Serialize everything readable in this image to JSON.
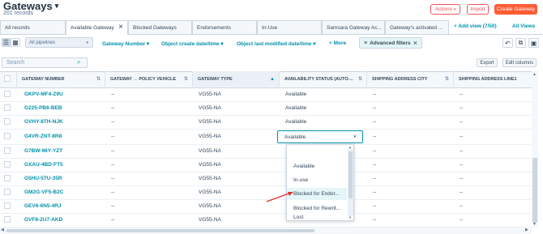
{
  "header": {
    "title": "Gateways",
    "subtitle": "201 records",
    "actions_label": "Actions",
    "import_label": "Import",
    "create_label": "Create Gateway"
  },
  "tabs": [
    {
      "label": "All records"
    },
    {
      "label": "Available Gateway",
      "active": true
    },
    {
      "label": "Blocked Gateways"
    },
    {
      "label": "Endorsements"
    },
    {
      "label": "In-Use"
    },
    {
      "label": "Samsara Gateway Ac..."
    },
    {
      "label": "Gateway's activated ..."
    }
  ],
  "tab_actions": {
    "add_view": "+ Add view (7/50)",
    "all_views": "All Views"
  },
  "filters": {
    "pipeline": "All pipelines",
    "gateway_number": "Gateway Number",
    "create_date": "Object create date/time",
    "modified_date": "Object last modified date/time",
    "more": "+ More",
    "advanced": "Advanced filters"
  },
  "search": {
    "placeholder": "Search",
    "export_label": "Export",
    "edit_columns_label": "Edit columns"
  },
  "table": {
    "columns": [
      "GATEWAY NUMBER",
      "GATEWAY → POLICY VEHICLE",
      "GATEWAY TYPE",
      "AVAILABILITY STATUS (AUTO-...",
      "SHIPPING ADDRESS CITY",
      "SHIPPING ADDRESS LINE1"
    ],
    "rows": [
      {
        "gateway": "GKPV-MF4-Z9U",
        "vehicle": "--",
        "type": "VG55-NA",
        "status": "Available",
        "city": "--",
        "line1": "--"
      },
      {
        "gateway": "G225-PB6-BEB",
        "vehicle": "--",
        "type": "VG55-NA",
        "status": "Available",
        "city": "--",
        "line1": "--"
      },
      {
        "gateway": "GVHY-8TH-NJK",
        "vehicle": "--",
        "type": "VG55-NA",
        "status": "Available",
        "city": "--",
        "line1": "--"
      },
      {
        "gateway": "G4VR-ZNT-8R8",
        "vehicle": "--",
        "type": "VG55-NA",
        "status": "Available",
        "city": "--",
        "line1": "--"
      },
      {
        "gateway": "G7BW-96Y-YZT",
        "vehicle": "--",
        "type": "VG55-NA",
        "status": "",
        "city": "--",
        "line1": "--"
      },
      {
        "gateway": "GXAU-4BD-FT5",
        "vehicle": "--",
        "type": "VG55-NA",
        "status": "",
        "city": "--",
        "line1": "--"
      },
      {
        "gateway": "G5HU-5TU-35R",
        "vehicle": "--",
        "type": "VG55-NA",
        "status": "",
        "city": "--",
        "line1": "--"
      },
      {
        "gateway": "GM2G-VF5-B2C",
        "vehicle": "--",
        "type": "VG55-NA",
        "status": "",
        "city": "--",
        "line1": "--"
      },
      {
        "gateway": "GEV6-6N5-4RJ",
        "vehicle": "--",
        "type": "VG55-NA",
        "status": "",
        "city": "--",
        "line1": "--"
      },
      {
        "gateway": "GVF8-2U7-AKD",
        "vehicle": "--",
        "type": "VG55-NA",
        "status": "",
        "city": "--",
        "line1": "--"
      }
    ]
  },
  "status_dropdown": {
    "current": "Available",
    "options": [
      "Available",
      "In-use",
      "Blocked for Endor...",
      "Blocked for Rewrit...",
      "Lost"
    ]
  },
  "colors": {
    "accent": "#0091ae",
    "brand": "#ff5c35",
    "annotation": "#e0312f"
  }
}
